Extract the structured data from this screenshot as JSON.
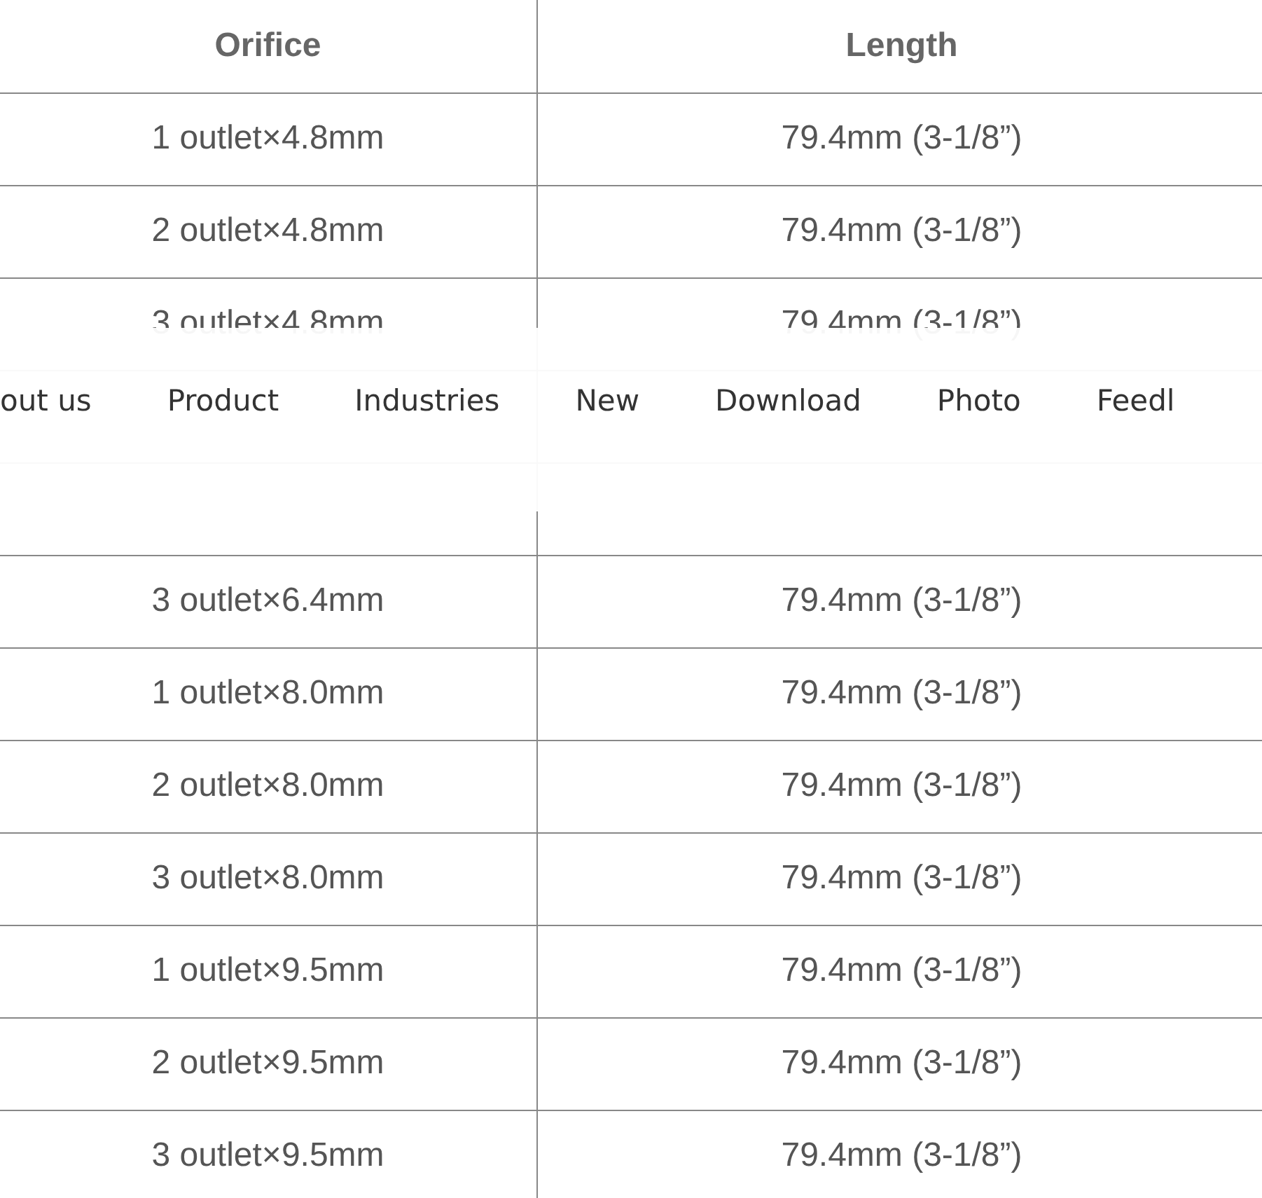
{
  "table": {
    "columns": [
      "Orifice",
      "Length"
    ],
    "rows": [
      {
        "cells": [
          "1 outlet×4.8mm",
          "79.4mm (3-1/8”)"
        ]
      },
      {
        "cells": [
          "2 outlet×4.8mm",
          "79.4mm (3-1/8”)"
        ]
      },
      {
        "cells": [
          "3 outlet×4.8mm",
          "79.4mm (3-1/8”)"
        ]
      },
      {
        "covered": true
      },
      {
        "covered": true
      },
      {
        "cells": [
          "3 outlet×6.4mm",
          "79.4mm (3-1/8”)"
        ]
      },
      {
        "cells": [
          "1 outlet×8.0mm",
          "79.4mm (3-1/8”)"
        ]
      },
      {
        "cells": [
          "2 outlet×8.0mm",
          "79.4mm (3-1/8”)"
        ]
      },
      {
        "cells": [
          "3 outlet×8.0mm",
          "79.4mm (3-1/8”)"
        ]
      },
      {
        "cells": [
          "1 outlet×9.5mm",
          "79.4mm (3-1/8”)"
        ]
      },
      {
        "cells": [
          "2 outlet×9.5mm",
          "79.4mm (3-1/8”)"
        ]
      },
      {
        "cells": [
          "3 outlet×9.5mm",
          "79.4mm (3-1/8”)"
        ]
      }
    ]
  },
  "nav": {
    "items": [
      "out us",
      "Product",
      "Industries",
      "New",
      "Download",
      "Photo",
      "Feedl"
    ]
  }
}
